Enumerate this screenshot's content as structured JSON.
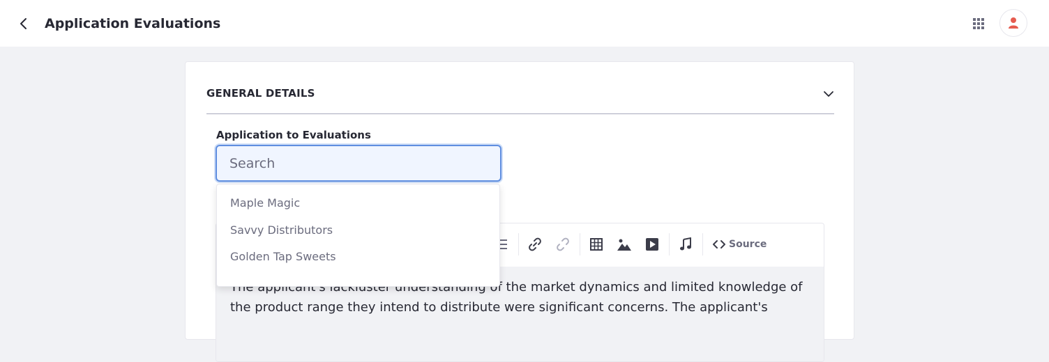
{
  "header": {
    "title": "Application Evaluations",
    "back_icon": "chevron-left-icon",
    "apps_icon": "grid-icon",
    "avatar_icon": "user-icon"
  },
  "section": {
    "title": "GENERAL DETAILS",
    "toggle_icon": "chevron-down-icon"
  },
  "field": {
    "label": "Application to Evaluations",
    "value": "",
    "placeholder": "Search"
  },
  "dropdown": {
    "options": [
      "Maple Magic",
      "Savvy Distributors",
      "Golden Tap Sweets"
    ]
  },
  "editor": {
    "toolbar": {
      "source_label": "Source"
    },
    "content": "The applicant's lackluster understanding of the market dynamics and limited knowledge of the product range they intend to distribute were significant concerns. The applicant's"
  },
  "colors": {
    "accent": "#5f8ee0",
    "avatar": "#e65c4f"
  }
}
